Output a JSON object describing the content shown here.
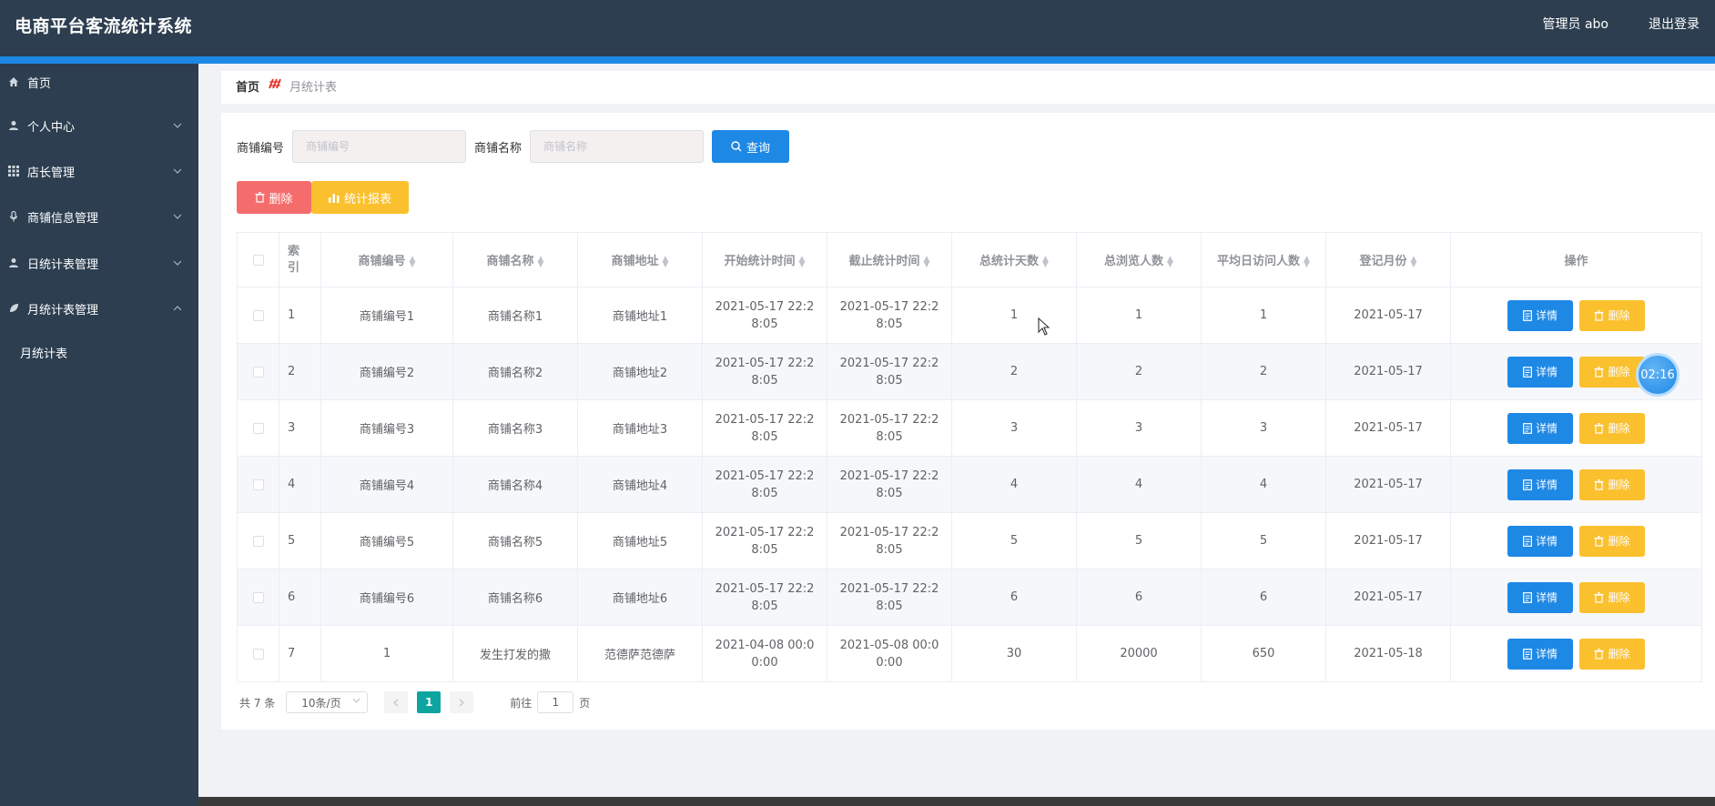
{
  "header": {
    "app_title": "电商平台客流统计系统",
    "user_info": "管理员 abo",
    "logout": "退出登录"
  },
  "sidebar": {
    "items": [
      {
        "label": "首页",
        "icon": "home-icon"
      },
      {
        "label": "个人中心",
        "icon": "user-icon"
      },
      {
        "label": "店长管理",
        "icon": "grid-icon"
      },
      {
        "label": "商铺信息管理",
        "icon": "mic-icon"
      },
      {
        "label": "日统计表管理",
        "icon": "user-icon"
      },
      {
        "label": "月统计表管理",
        "icon": "leaf-icon"
      }
    ],
    "submenu": {
      "label": "月统计表"
    }
  },
  "breadcrumb": {
    "home": "首页",
    "current": "月统计表"
  },
  "search": {
    "shop_no_label": "商铺编号",
    "shop_no_placeholder": "商铺编号",
    "shop_name_label": "商铺名称",
    "shop_name_placeholder": "商铺名称",
    "query_button": "查询"
  },
  "toolbar": {
    "delete_button": "删除",
    "report_button": "统计报表"
  },
  "table": {
    "headers": [
      "索引",
      "商铺编号",
      "商铺名称",
      "商铺地址",
      "开始统计时间",
      "截止统计时间",
      "总统计天数",
      "总浏览人数",
      "平均日访问人数",
      "登记月份",
      "操作"
    ],
    "detail_label": "详情",
    "delete_label": "删除",
    "rows": [
      {
        "index": "1",
        "shop_no": "商铺编号1",
        "shop_name": "商铺名称1",
        "address": "商铺地址1",
        "start": "2021-05-17 22:28:05",
        "end": "2021-05-17 22:28:05",
        "days": "1",
        "views": "1",
        "avg": "1",
        "month": "2021-05-17"
      },
      {
        "index": "2",
        "shop_no": "商铺编号2",
        "shop_name": "商铺名称2",
        "address": "商铺地址2",
        "start": "2021-05-17 22:28:05",
        "end": "2021-05-17 22:28:05",
        "days": "2",
        "views": "2",
        "avg": "2",
        "month": "2021-05-17"
      },
      {
        "index": "3",
        "shop_no": "商铺编号3",
        "shop_name": "商铺名称3",
        "address": "商铺地址3",
        "start": "2021-05-17 22:28:05",
        "end": "2021-05-17 22:28:05",
        "days": "3",
        "views": "3",
        "avg": "3",
        "month": "2021-05-17"
      },
      {
        "index": "4",
        "shop_no": "商铺编号4",
        "shop_name": "商铺名称4",
        "address": "商铺地址4",
        "start": "2021-05-17 22:28:05",
        "end": "2021-05-17 22:28:05",
        "days": "4",
        "views": "4",
        "avg": "4",
        "month": "2021-05-17"
      },
      {
        "index": "5",
        "shop_no": "商铺编号5",
        "shop_name": "商铺名称5",
        "address": "商铺地址5",
        "start": "2021-05-17 22:28:05",
        "end": "2021-05-17 22:28:05",
        "days": "5",
        "views": "5",
        "avg": "5",
        "month": "2021-05-17"
      },
      {
        "index": "6",
        "shop_no": "商铺编号6",
        "shop_name": "商铺名称6",
        "address": "商铺地址6",
        "start": "2021-05-17 22:28:05",
        "end": "2021-05-17 22:28:05",
        "days": "6",
        "views": "6",
        "avg": "6",
        "month": "2021-05-17"
      },
      {
        "index": "7",
        "shop_no": "1",
        "shop_name": "发生打发的撒",
        "address": "范德萨范德萨",
        "start": "2021-04-08 00:00:00",
        "end": "2021-05-08 00:00:00",
        "days": "30",
        "views": "20000",
        "avg": "650",
        "month": "2021-05-18"
      }
    ]
  },
  "pagination": {
    "total": "共 7 条",
    "page_size": "10条/页",
    "current_page": "1",
    "goto_label": "前往",
    "goto_value": "1",
    "page_suffix": "页"
  },
  "timer": {
    "text": "02:16"
  },
  "colors": {
    "header_bg": "#2c3e50",
    "accent": "#1e88e5",
    "danger": "#f56c6c",
    "warning": "#fbc02d",
    "pager_active": "#0ea5a0"
  }
}
